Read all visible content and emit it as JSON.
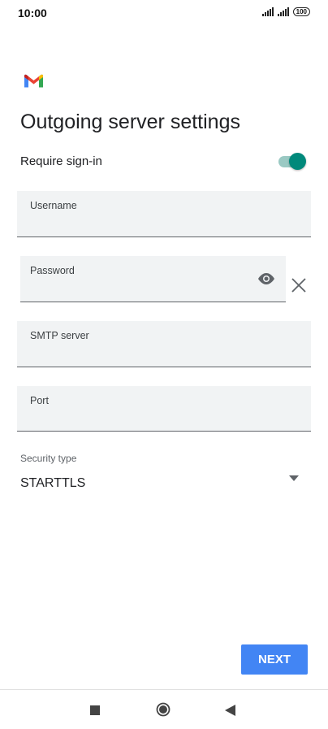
{
  "status_bar": {
    "time": "10:00",
    "battery": "100"
  },
  "page": {
    "title": "Outgoing server settings"
  },
  "require_signin": {
    "label": "Require sign-in",
    "enabled": true
  },
  "fields": {
    "username": {
      "label": "Username",
      "value": ""
    },
    "password": {
      "label": "Password",
      "value": ""
    },
    "smtp_server": {
      "label": "SMTP server",
      "value": ""
    },
    "port": {
      "label": "Port",
      "value": ""
    }
  },
  "security": {
    "label": "Security type",
    "value": "STARTTLS"
  },
  "actions": {
    "next_label": "NEXT"
  },
  "colors": {
    "accent": "#00897b",
    "button": "#4285f4",
    "field_bg": "#f1f3f4"
  },
  "icons": [
    "gmail-logo",
    "eye-icon",
    "close-icon",
    "dropdown-arrow-icon",
    "recents-icon",
    "home-icon",
    "back-icon"
  ]
}
